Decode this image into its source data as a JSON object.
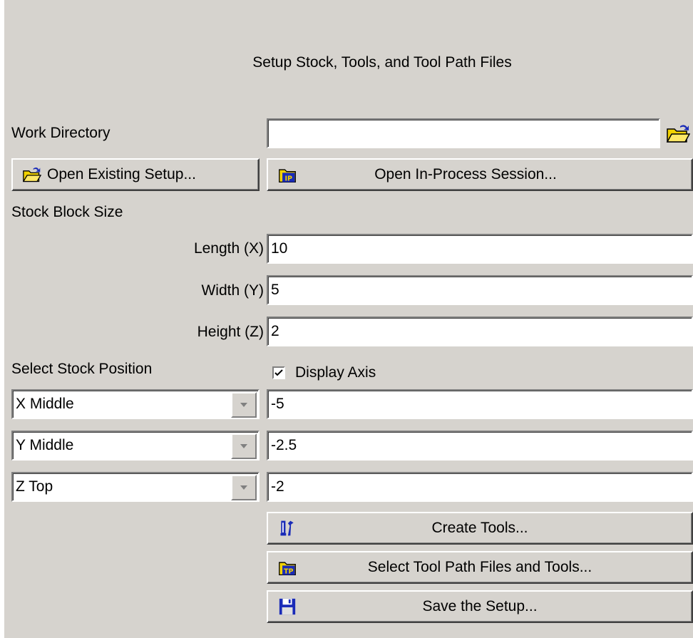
{
  "title": "Setup Stock, Tools, and Tool Path Files",
  "work_directory": {
    "label": "Work Directory",
    "value": "",
    "browse_icon": "folder-open-icon"
  },
  "open_existing_label": "Open Existing Setup...",
  "open_inprocess_label": "Open In-Process Session...",
  "stock_block": {
    "heading": "Stock Block Size",
    "length_label": "Length (X)",
    "length_value": "10",
    "width_label": "Width (Y)",
    "width_value": "5",
    "height_label": "Height (Z)",
    "height_value": "2"
  },
  "stock_position": {
    "heading": "Select Stock Position",
    "display_axis_label": "Display Axis",
    "display_axis_checked": true,
    "x_select": "X Middle",
    "x_value": "-5",
    "y_select": "Y Middle",
    "y_value": "-2.5",
    "z_select": "Z Top",
    "z_value": "-2"
  },
  "actions": {
    "create_tools": "Create Tools...",
    "select_toolpath": "Select Tool Path Files and Tools...",
    "save_setup": "Save the Setup..."
  },
  "colors": {
    "background": "#d6d3ce",
    "icon_blue": "#1a2bb8",
    "icon_yellow": "#f2d200"
  }
}
